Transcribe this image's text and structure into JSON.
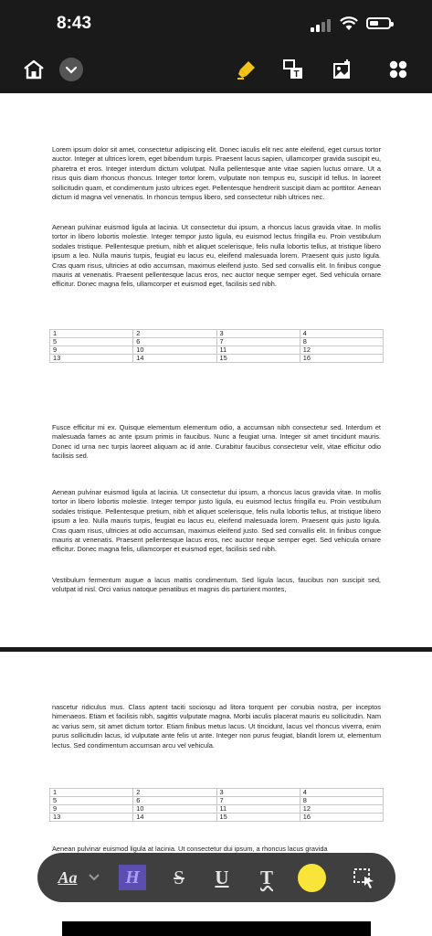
{
  "status_bar": {
    "time": "8:43"
  },
  "toolbar": {
    "icons": [
      "home-icon",
      "chevron-down-icon",
      "highlighter-icon",
      "text-recognition-icon",
      "image-edit-icon",
      "grid-apps-icon"
    ],
    "highlight_color": "#f0c419"
  },
  "page1": {
    "para1": "Lorem ipsum dolor sit amet, consectetur adipiscing elit. Donec iaculis elit nec ante eleifend, eget cursus tortor auctor. Integer at ultrices lorem, eget bibendum turpis. Praesent lacus sapien, ullamcorper gravida suscipit eu, pharetra et eros. Integer interdum dictum volutpat. Nulla pellentesque ante vitae sapien luctus ornare. Ut a risus quis diam rhoncus rhoncus. Integer tortor lorem, vulputate non tempus eu, suscipit id tellus. In laoreet sollicitudin quam, et condimentum justo ultrices eget. Pellentesque hendrerit suscipit diam ac porttitor. Aenean dictum id magna vel venenatis. In rhoncus tempus libero, sed consectetur nibh ultrices nec.",
    "para2": "Aenean pulvinar euismod ligula at lacinia. Ut consectetur dui ipsum, a rhoncus lacus gravida vitae. In mollis tortor in libero lobortis molestie. Integer tempor justo ligula, eu euismod lectus fringilla eu. Proin vestibulum sodales tristique. Pellentesque pretium, nibh et aliquet scelerisque, felis nulla lobortis tellus, at tristique libero ipsum a leo. Nulla mauris turpis, feugiat eu lacus eu, eleifend malesuada lorem. Praesent quis justo ligula. Cras quam risus, ultricies at odio accumsan, maximus eleifend justo. Sed sed convallis elit. In finibus congue mauris at venenatis. Praesent pellentesque lacus eros, nec auctor neque semper eget. Sed vehicula ornare efficitur. Donec magna felis, ullamcorper et euismod eget, facilisis sed nibh.",
    "table": [
      [
        "1",
        "2",
        "3",
        "4"
      ],
      [
        "5",
        "6",
        "7",
        "8"
      ],
      [
        "9",
        "10",
        "11",
        "12"
      ],
      [
        "13",
        "14",
        "15",
        "16"
      ]
    ],
    "para3": "Fusce efficitur mi ex. Quisque elementum elementum odio, a accumsan nibh consectetur sed. Interdum et malesuada fames ac ante ipsum primis in faucibus. Nunc a feugiat urna. Integer sit amet tincidunt mauris. Donec id urna nec turpis laoreet aliquam ac id ante. Curabitur faucibus consectetur velit, vitae efficitur odio facilisis sed.",
    "para4": "Aenean pulvinar euismod ligula at lacinia. Ut consectetur dui ipsum, a rhoncus lacus gravida vitae. In mollis tortor in libero lobortis molestie. Integer tempor justo ligula, eu euismod lectus fringilla eu. Proin vestibulum sodales tristique. Pellentesque pretium, nibh et aliquet scelerisque, felis nulla lobortis tellus, at tristique libero ipsum a leo. Nulla mauris turpis, feugiat eu lacus eu, eleifend malesuada lorem. Praesent quis justo ligula. Cras quam risus, ultricies at odio accumsan, maximus eleifend justo. Sed sed convallis elit. In finibus congue mauris at venenatis. Praesent pellentesque lacus eros, nec auctor neque semper eget. Sed vehicula ornare efficitur. Donec magna felis, ullamcorper et euismod eget, facilisis sed nibh.",
    "para5": "Vestibulum fermentum augue a lacus mattis condimentum. Sed ligula lacus, faucibus non suscipit sed, volutpat id nisl. Orci varius natoque penatibus et magnis dis parturient montes,"
  },
  "page2": {
    "para1": "nascetur ridiculus mus. Class aptent taciti sociosqu ad litora torquent per conubia nostra, per inceptos himenaeos. Etiam et facilisis nibh, sagittis vulputate magna. Morbi iaculis placerat mauris eu sollicitudin. Nam ac varius sem, sit amet dictum tortor. Etiam finibus metus lacus. Ut tincidunt, lacus vel rhoncus viverra, enim purus sollicitudin lacus, id vulputate ante felis ut ante. Integer non purus feugiat, blandit lorem ut, elementum lectus. Sed condimentum accumsan arcu vel vehicula.",
    "table": [
      [
        "1",
        "2",
        "3",
        "4"
      ],
      [
        "5",
        "6",
        "7",
        "8"
      ],
      [
        "9",
        "10",
        "11",
        "12"
      ],
      [
        "13",
        "14",
        "15",
        "16"
      ]
    ],
    "para2_partial": "Aenean pulvinar euismod ligula at lacinia. Ut consectetur dui ipsum, a rhoncus lacus gravida"
  },
  "format_bar": {
    "font_label": "Aa",
    "highlight_label": "H",
    "strike_label": "S",
    "underline_label": "U",
    "text_label": "T",
    "selected_color": "#f9e43a",
    "highlight_accent": "#7b6cf0"
  }
}
